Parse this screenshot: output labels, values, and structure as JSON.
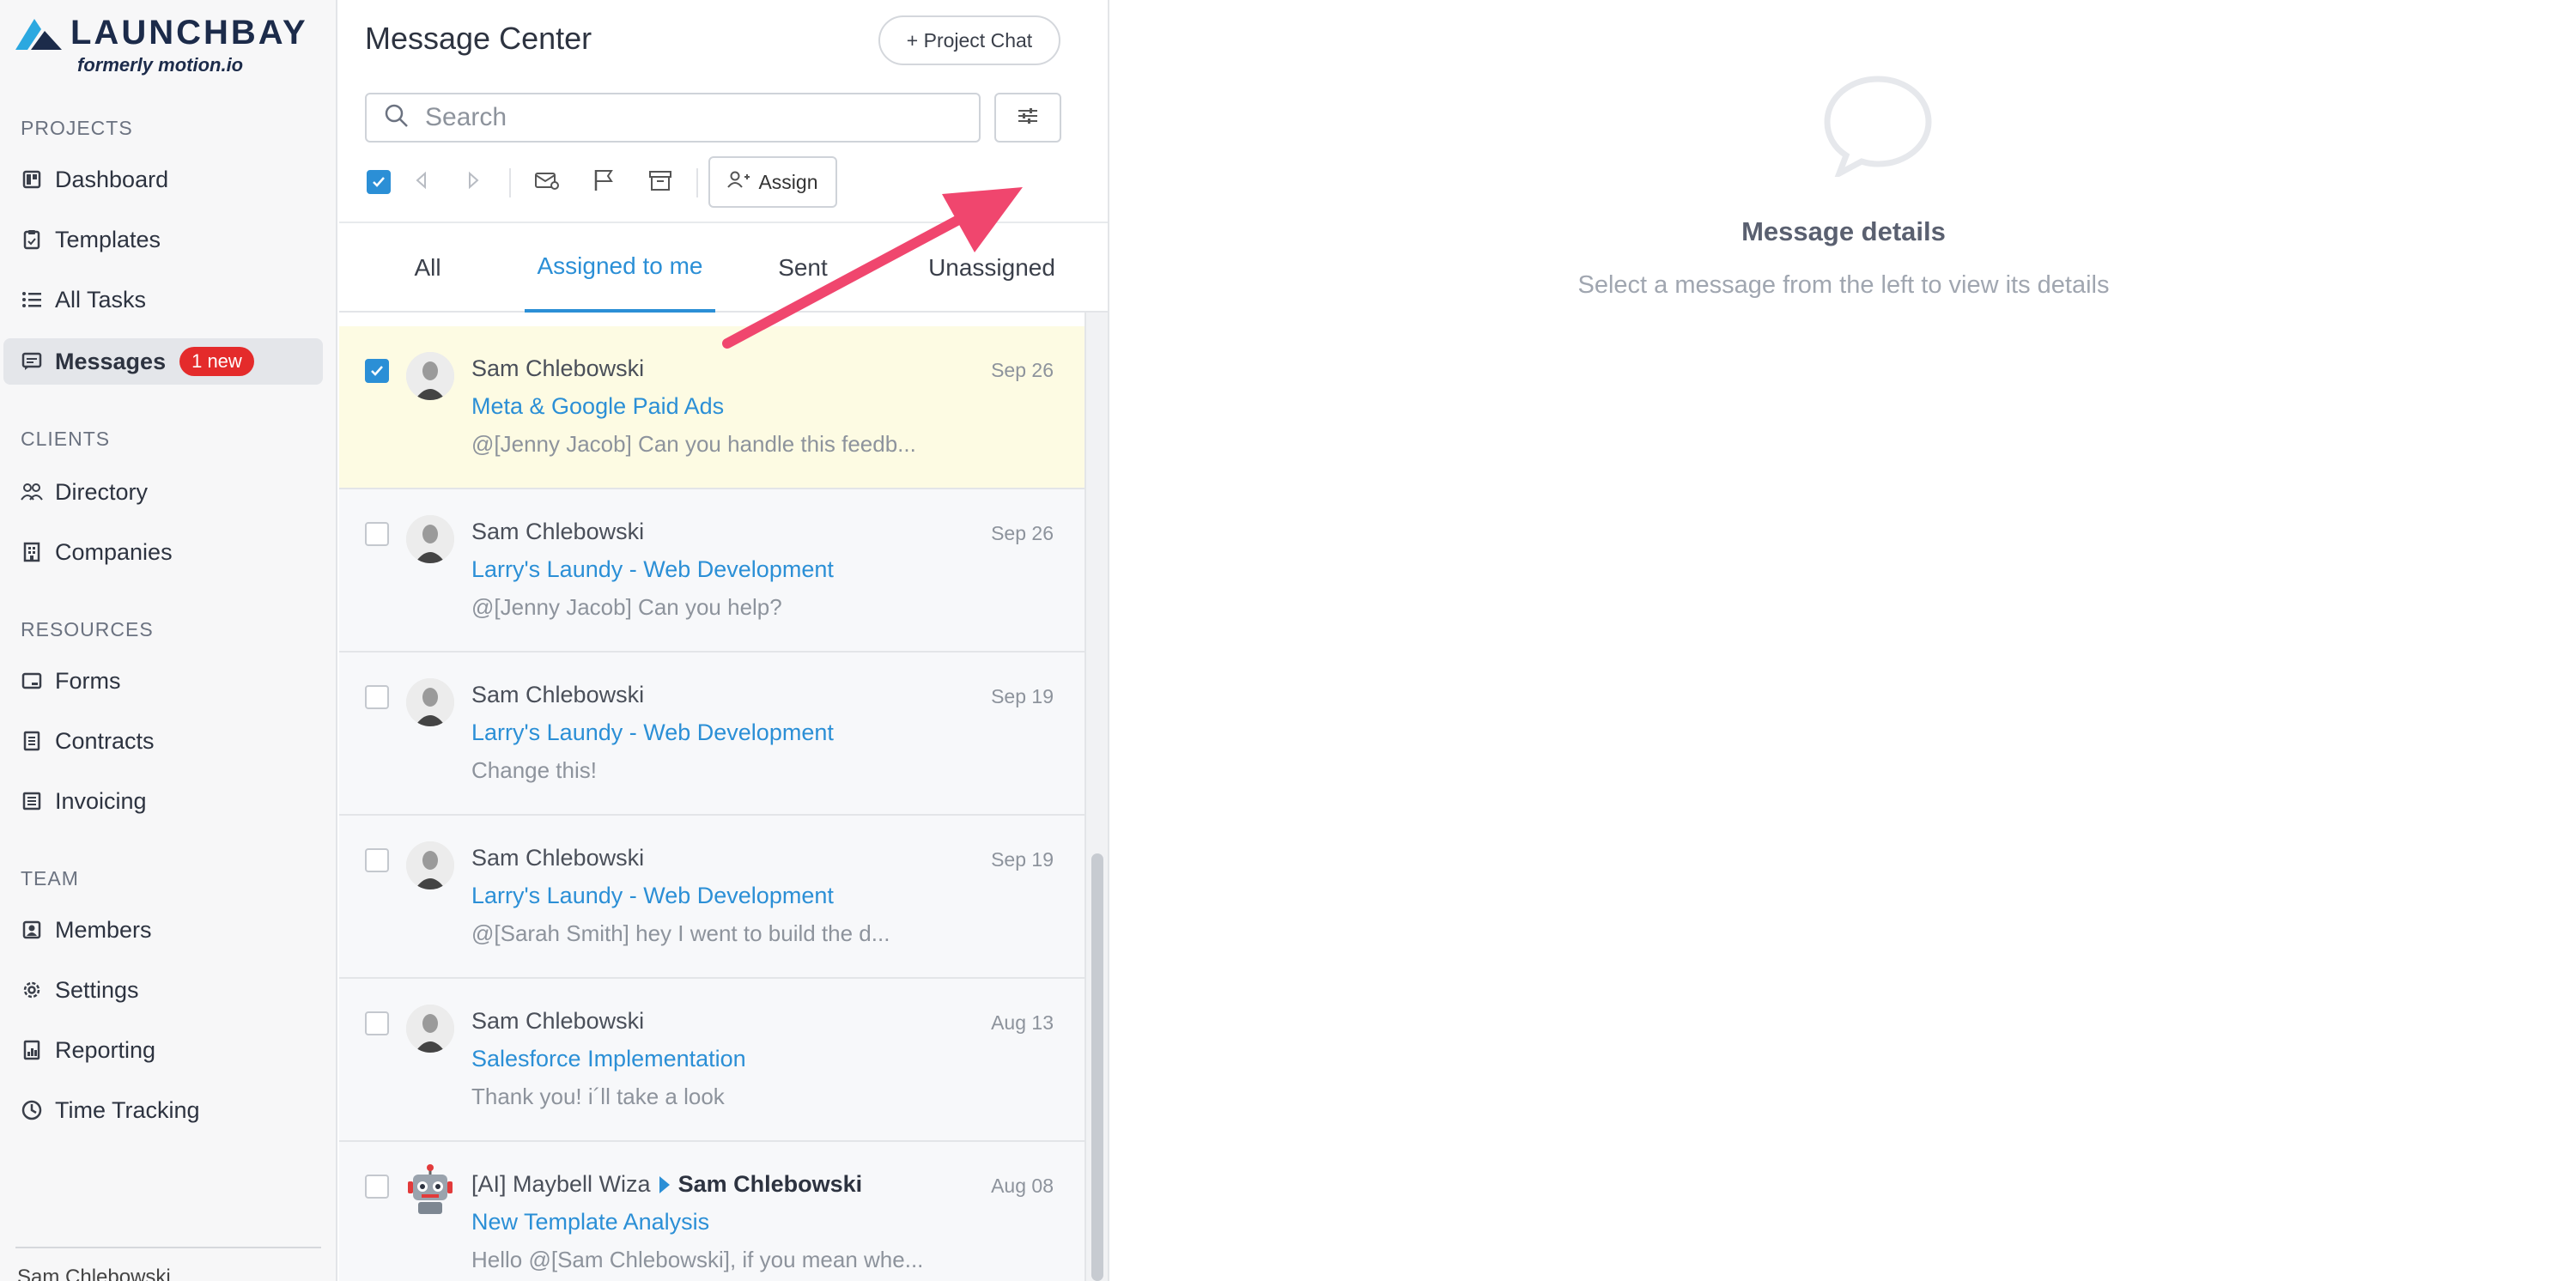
{
  "brand": {
    "name": "LAUNCHBAY",
    "tagline": "formerly motion.io",
    "color": "#1c2b4a",
    "accent": "#2ba8e0"
  },
  "sidebar": {
    "sections": [
      {
        "title": "PROJECTS",
        "items": [
          {
            "label": "Dashboard",
            "icon": "dashboard-icon"
          },
          {
            "label": "Templates",
            "icon": "clipboard-icon"
          },
          {
            "label": "All Tasks",
            "icon": "list-icon"
          },
          {
            "label": "Messages",
            "icon": "message-icon",
            "badge": "1 new",
            "active": true
          }
        ]
      },
      {
        "title": "CLIENTS",
        "items": [
          {
            "label": "Directory",
            "icon": "people-icon"
          },
          {
            "label": "Companies",
            "icon": "building-icon"
          }
        ]
      },
      {
        "title": "RESOURCES",
        "items": [
          {
            "label": "Forms",
            "icon": "form-icon"
          },
          {
            "label": "Contracts",
            "icon": "document-icon"
          },
          {
            "label": "Invoicing",
            "icon": "invoice-icon"
          }
        ]
      },
      {
        "title": "TEAM",
        "items": [
          {
            "label": "Members",
            "icon": "member-icon"
          },
          {
            "label": "Settings",
            "icon": "gear-icon"
          },
          {
            "label": "Reporting",
            "icon": "report-icon"
          },
          {
            "label": "Time Tracking",
            "icon": "clock-icon"
          }
        ]
      }
    ],
    "user_label": "Sam Chlebowski"
  },
  "message_center": {
    "title": "Message Center",
    "project_chat_label": "+ Project Chat",
    "search_placeholder": "Search",
    "assign_label": "Assign",
    "tabs": [
      {
        "label": "All"
      },
      {
        "label": "Assigned to me",
        "active": true
      },
      {
        "label": "Sent"
      },
      {
        "label": "Unassigned"
      }
    ],
    "messages": [
      {
        "sender": "Sam Chlebowski",
        "date": "Sep 26",
        "subject": "Meta & Google Paid Ads",
        "preview": "@[Jenny Jacob] Can you handle this feedb...",
        "checked": true,
        "selected": true
      },
      {
        "sender": "Sam Chlebowski",
        "date": "Sep 26",
        "subject": "Larry's Laundy - Web Development",
        "preview": "@[Jenny Jacob] Can you help?"
      },
      {
        "sender": "Sam Chlebowski",
        "date": "Sep 19",
        "subject": "Larry's Laundy - Web Development",
        "preview": "Change this!"
      },
      {
        "sender": "Sam Chlebowski",
        "date": "Sep 19",
        "subject": "Larry's Laundy - Web Development",
        "preview": "@[Sarah Smith] hey I went to build the d..."
      },
      {
        "sender": "Sam Chlebowski",
        "date": "Aug 13",
        "subject": "Salesforce Implementation",
        "preview": "Thank you! i´ll take a look"
      },
      {
        "sender": "[AI] Maybell Wiza",
        "recipient": "Sam Chlebowski",
        "date": "Aug 08",
        "subject": "New Template Analysis",
        "preview": "Hello @[Sam Chlebowski], if you mean whe...",
        "robot": true
      }
    ]
  },
  "detail": {
    "title": "Message details",
    "subtitle": "Select a message from the left to view its details"
  },
  "colors": {
    "link": "#2b8fd6",
    "badge": "#e42b2b",
    "selected_row": "#fdfbe3",
    "callout_arrow": "#f0466e"
  }
}
